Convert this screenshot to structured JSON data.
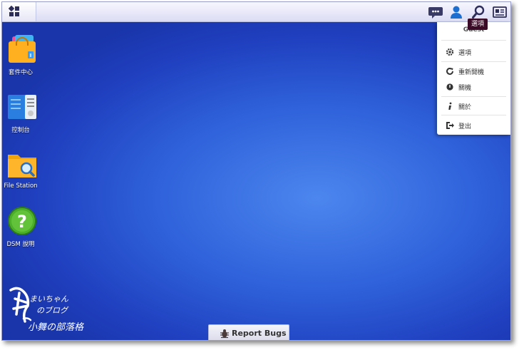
{
  "taskbar": {
    "tooltip": "選項",
    "icons": [
      "main-menu-icon",
      "chat-icon",
      "user-icon",
      "search-icon",
      "widgets-icon"
    ]
  },
  "user_menu": {
    "user": "Guest",
    "items": [
      {
        "label": "選項",
        "icon": "gear-icon"
      },
      {
        "label": "重新開機",
        "icon": "restart-icon"
      },
      {
        "label": "關機",
        "icon": "power-icon"
      },
      {
        "label": "關於",
        "icon": "info-icon"
      },
      {
        "label": "登出",
        "icon": "logout-icon"
      }
    ]
  },
  "desktop": {
    "icons": [
      {
        "label": "套件中心"
      },
      {
        "label": "控制台"
      },
      {
        "label": "File Station"
      },
      {
        "label": "DSM 說明"
      }
    ]
  },
  "report_bugs": {
    "label": "Report Bugs"
  },
  "watermark": {
    "line1": "まいちゃん",
    "line2": "のブログ",
    "line3": "小舞の部落格"
  },
  "colors": {
    "desktop": "#2f62db",
    "tooltip": "#3a0a26",
    "accent": "#1a4fa0"
  }
}
